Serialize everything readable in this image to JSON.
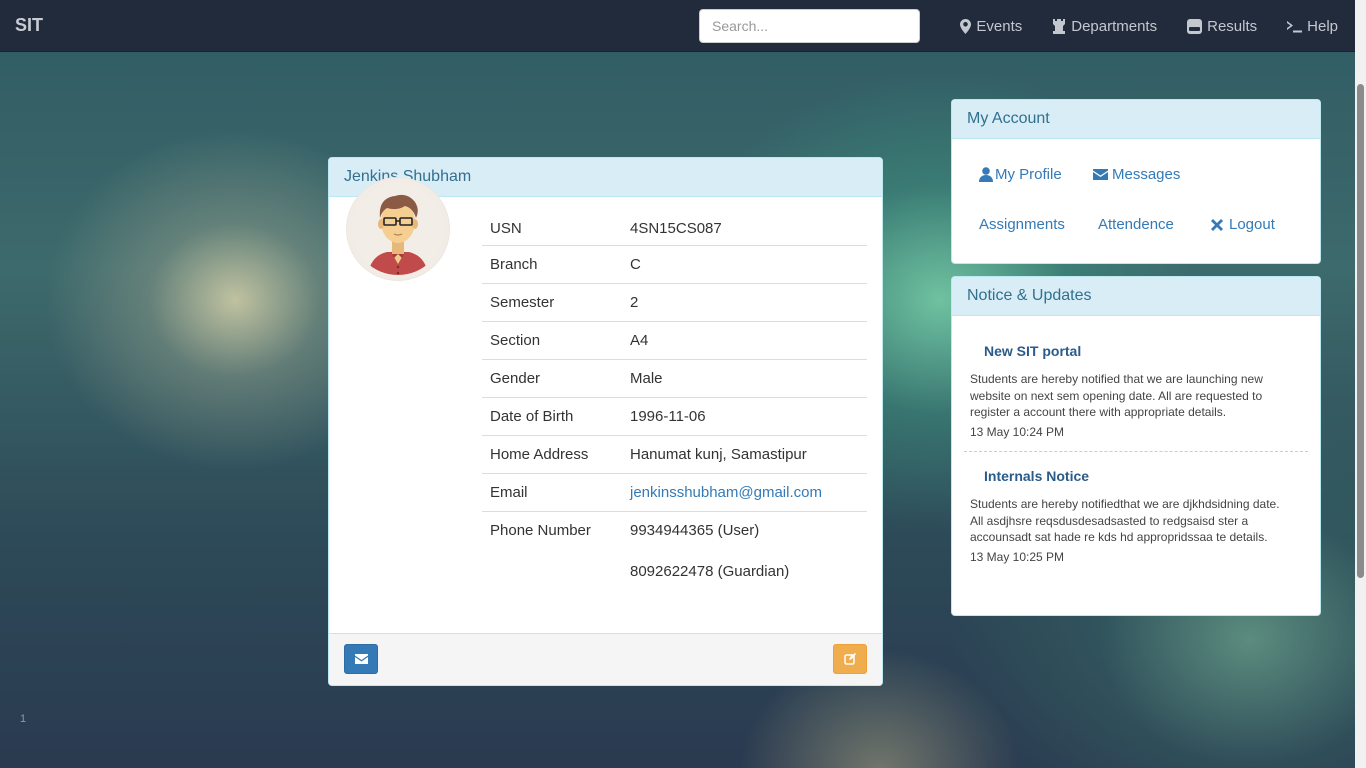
{
  "navbar": {
    "brand": "SIT",
    "search_placeholder": "Search...",
    "links": [
      {
        "label": "Events",
        "icon": "map-marker-icon"
      },
      {
        "label": "Departments",
        "icon": "tower-icon"
      },
      {
        "label": "Results",
        "icon": "hdd-icon"
      },
      {
        "label": "Help",
        "icon": "console-icon"
      }
    ]
  },
  "profile": {
    "name": "Jenkins Shubham",
    "avatar_icon": "user-avatar",
    "fields": [
      {
        "label": "USN",
        "value": "4SN15CS087"
      },
      {
        "label": "Branch",
        "value": "C"
      },
      {
        "label": "Semester",
        "value": "2"
      },
      {
        "label": "Section",
        "value": "A4"
      },
      {
        "label": "Gender",
        "value": "Male"
      },
      {
        "label": "Date of Birth",
        "value": "1996-11-06"
      },
      {
        "label": "Home Address",
        "value": "Hanumat kunj, Samastipur"
      },
      {
        "label": "Email",
        "value": "jenkinsshubham@gmail.com"
      },
      {
        "label": "Phone Number",
        "value": "9934944365 (User)",
        "value2": "8092622478 (Guardian)"
      }
    ]
  },
  "account": {
    "title": "My Account",
    "links": [
      {
        "label": "My Profile",
        "icon": "user-icon"
      },
      {
        "label": "Messages",
        "icon": "envelope-icon"
      },
      {
        "label": "Assignments"
      },
      {
        "label": "Attendence"
      },
      {
        "label": "Logout",
        "icon": "remove-icon"
      }
    ]
  },
  "notices": {
    "title": "Notice & Updates",
    "items": [
      {
        "title": "New SIT portal",
        "body": "Students are hereby notified that we are launching new website on next sem opening date. All are requested to register a account there with appropriate details.",
        "time": "13 May 10:24 PM"
      },
      {
        "title": "Internals Notice",
        "body": "Students are hereby notifiedthat we are djkhdsidning date. All asdjhsre reqsdusdesadsasted to redgsaisd ster a accounsadt sat hade re kds hd appropridssaa te details.",
        "time": "13 May 10:25 PM"
      }
    ]
  },
  "page_number": "1",
  "colors": {
    "navbar": "#222b3c",
    "panel_heading": "#d9edf7",
    "heading_text": "#31708f",
    "link": "#337ab7",
    "btn_primary": "#337ab7",
    "btn_warning": "#f0ad4e"
  }
}
